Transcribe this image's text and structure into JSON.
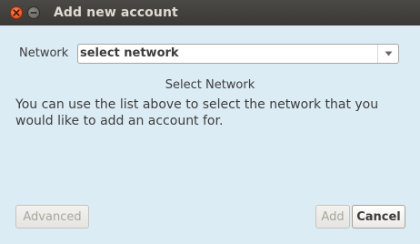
{
  "window": {
    "title": "Add new account",
    "controls": {
      "close_icon": "close-icon",
      "minimize_icon": "minimize-icon"
    }
  },
  "network": {
    "label": "Network",
    "selected": "select network",
    "dropdown_icon": "chevron-down-icon"
  },
  "info": {
    "heading": "Select Network",
    "description": "You can use the list above to select the network that you would like to add an account for."
  },
  "buttons": {
    "advanced": {
      "label": "Advanced",
      "enabled": false
    },
    "add": {
      "label": "Add",
      "enabled": false
    },
    "cancel": {
      "label": "Cancel",
      "enabled": true
    }
  },
  "colors": {
    "titlebar": "#3c3b37",
    "background": "#dcecf5",
    "close_button": "#e8582a"
  }
}
